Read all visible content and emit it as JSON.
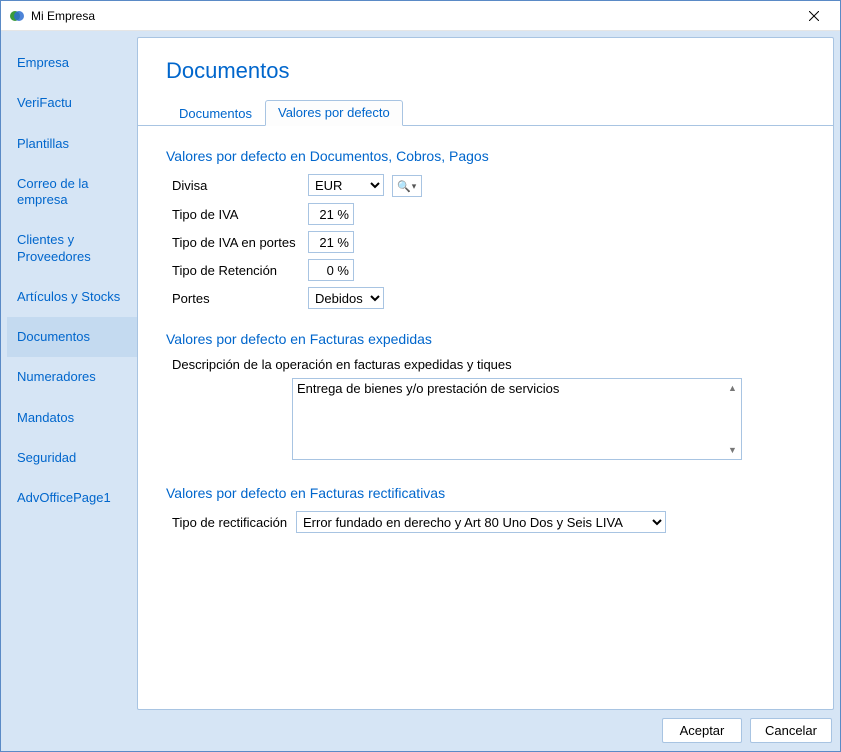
{
  "window": {
    "title": "Mi Empresa"
  },
  "sidebar": {
    "items": [
      {
        "label": "Empresa"
      },
      {
        "label": "VeriFactu"
      },
      {
        "label": "Plantillas"
      },
      {
        "label": "Correo de la empresa"
      },
      {
        "label": "Clientes y Proveedores"
      },
      {
        "label": "Artículos y Stocks"
      },
      {
        "label": "Documentos"
      },
      {
        "label": "Numeradores"
      },
      {
        "label": "Mandatos"
      },
      {
        "label": "Seguridad"
      },
      {
        "label": "AdvOfficePage1"
      }
    ],
    "active_index": 6
  },
  "page": {
    "title": "Documentos",
    "tabs": [
      {
        "label": "Documentos"
      },
      {
        "label": "Valores por defecto"
      }
    ],
    "active_tab": 1
  },
  "section_dcp": {
    "title": "Valores por defecto en Documentos, Cobros, Pagos",
    "divisa_label": "Divisa",
    "divisa_value": "EUR",
    "tipo_iva_label": "Tipo de IVA",
    "tipo_iva_value": "21 %",
    "tipo_iva_portes_label": "Tipo de IVA en portes",
    "tipo_iva_portes_value": "21 %",
    "tipo_retencion_label": "Tipo de Retención",
    "tipo_retencion_value": "0 %",
    "portes_label": "Portes",
    "portes_value": "Debidos"
  },
  "section_exp": {
    "title": "Valores por defecto en Facturas expedidas",
    "desc_label": "Descripción de la operación en facturas expedidas y tiques",
    "desc_value": "Entrega de bienes y/o prestación de servicios"
  },
  "section_rect": {
    "title": "Valores por defecto en Facturas rectificativas",
    "tipo_rect_label": "Tipo de rectificación",
    "tipo_rect_value": "Error fundado en derecho y Art 80 Uno Dos y Seis LIVA"
  },
  "footer": {
    "accept": "Aceptar",
    "cancel": "Cancelar"
  }
}
